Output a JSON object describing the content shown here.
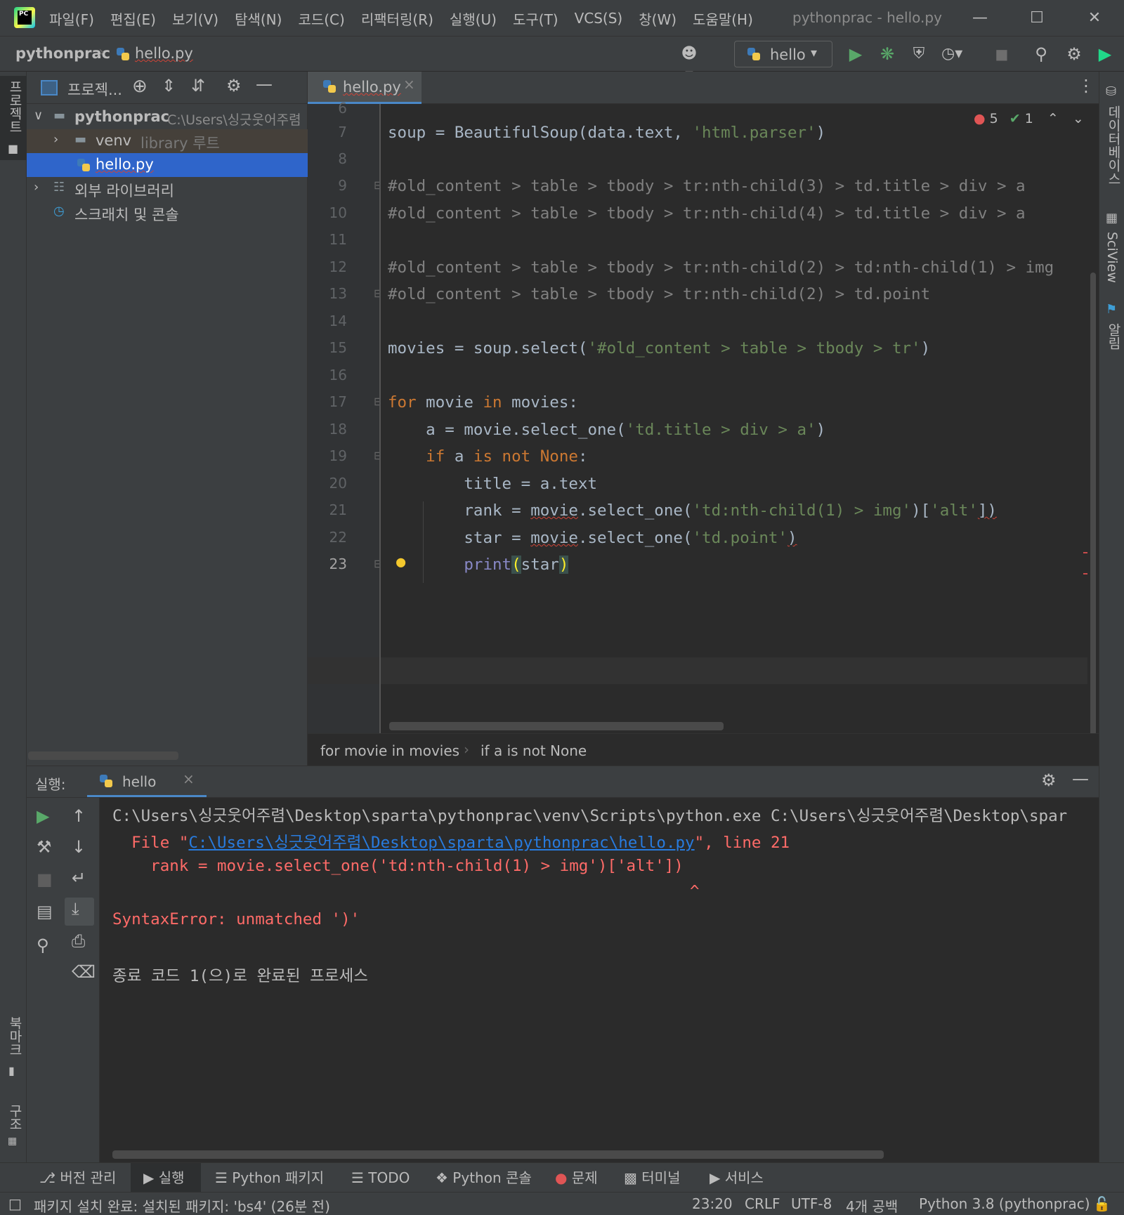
{
  "menu": [
    "파일(F)",
    "편집(E)",
    "보기(V)",
    "탐색(N)",
    "코드(C)",
    "리팩터링(R)",
    "실행(U)",
    "도구(T)",
    "VCS(S)",
    "창(W)",
    "도움말(H)"
  ],
  "window_title": "pythonprac - hello.py",
  "app_logo_text": "PC",
  "nav": {
    "project": "pythonprac",
    "file": "hello.py"
  },
  "run_config": "hello",
  "left_stripe": {
    "project": "프로젝트",
    "bookmarks": "북마크",
    "structure": "구조"
  },
  "right_stripe": {
    "database": "데이터베이스",
    "sciview": "SciView",
    "notifications": "알림"
  },
  "project_panel": {
    "title": "프로젝...",
    "tree": [
      {
        "name": "pythonprac",
        "path": "C:\\Users\\싱긋웃어주렴"
      },
      {
        "name": "venv",
        "hint": "library 루트"
      },
      {
        "name": "hello.py"
      },
      {
        "name": "외부 라이브러리"
      },
      {
        "name": "스크래치 및 콘솔"
      }
    ]
  },
  "editor": {
    "tab": "hello.py",
    "inspections": {
      "errors": "5",
      "warnings": "1"
    },
    "line_numbers": [
      "6",
      "7",
      "8",
      "9",
      "10",
      "11",
      "12",
      "13",
      "14",
      "15",
      "16",
      "17",
      "18",
      "19",
      "20",
      "21",
      "22",
      "23"
    ],
    "code": {
      "l7a": "soup = BeautifulSoup(data.text, ",
      "l7b": "'html.parser'",
      "l7c": ")",
      "l9": "#old_content > table > tbody > tr:nth-child(3) > td.title > div > a",
      "l10": "#old_content > table > tbody > tr:nth-child(4) > td.title > div > a",
      "l12": "#old_content > table > tbody > tr:nth-child(2) > td:nth-child(1) > img",
      "l13": "#old_content > table > tbody > tr:nth-child(2) > td.point",
      "l15a": "movies = soup.select(",
      "l15b": "'#old_content > table > tbody > tr'",
      "l15c": ")",
      "l17a": "for",
      "l17b": " movie ",
      "l17c": "in",
      "l17d": " movies:",
      "l18a": "    a = movie.select_one(",
      "l18b": "'td.title > div > a'",
      "l18c": ")",
      "l19a": "    if",
      "l19b": " a ",
      "l19c": "is not",
      "l19d": " None",
      "l19e": ":",
      "l20": "        title = a.text",
      "l21a": "        rank = ",
      "l21b": "movie",
      "l21c": ".select_one(",
      "l21d": "'td:nth-child(1) > img'",
      "l21e": ")[",
      "l21f": "'alt'",
      "l21g": "])",
      "l22a": "        star = ",
      "l22b": "movie",
      "l22c": ".select_one(",
      "l22d": "'td.point'",
      "l22e": ")",
      "l23a": "        ",
      "l23b": "print",
      "l23c": "(",
      "l23d": "star",
      "l23e": ")"
    },
    "breadcrumbs": [
      "for movie in movies",
      "if a is not None"
    ]
  },
  "run_panel": {
    "label": "실행:",
    "tab": "hello",
    "console": {
      "cmd": "C:\\Users\\싱긋웃어주렴\\Desktop\\sparta\\pythonprac\\venv\\Scripts\\python.exe C:\\Users\\싱긋웃어주렴\\Desktop\\spar",
      "file_prefix": "  File \"",
      "file_link": "C:\\Users\\싱긋웃어주렴\\Desktop\\sparta\\pythonprac\\hello.py",
      "file_suffix": "\", line 21",
      "src": "    rank = movie.select_one('td:nth-child(1) > img')['alt'])",
      "caret": "^",
      "error": "SyntaxError: unmatched ')'",
      "exit": "종료 코드 1(으)로 완료된 프로세스"
    }
  },
  "bottom_tabs": [
    "버전 관리",
    "실행",
    "Python 패키지",
    "TODO",
    "Python 콘솔",
    "문제",
    "터미널",
    "서비스"
  ],
  "status": {
    "message": "패키지 설치 완료: 설치된 패키지: 'bs4' (26분 전)",
    "position": "23:20",
    "line_sep": "CRLF",
    "encoding": "UTF-8",
    "indent": "4개 공백",
    "interpreter": "Python 3.8 (pythonprac)"
  },
  "colors": {
    "accent": "#4a88c7",
    "error": "#ff6b68",
    "keyword": "#cc7832",
    "string": "#6a8759",
    "comment": "#808080"
  }
}
